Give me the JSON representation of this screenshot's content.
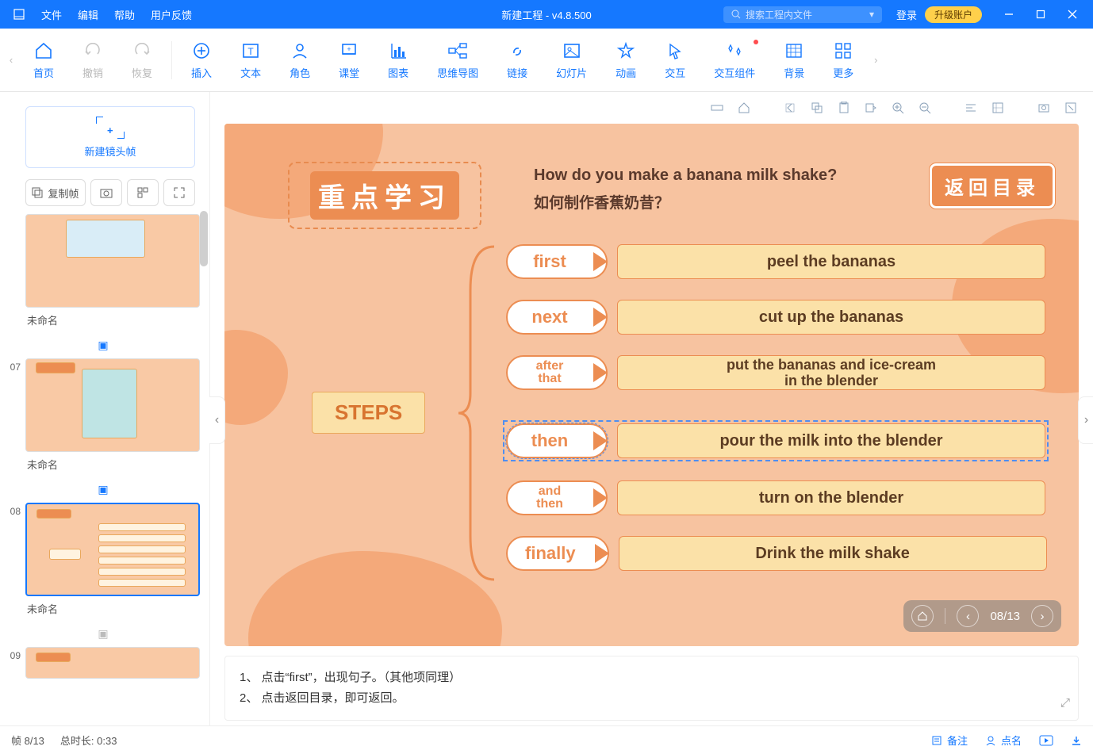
{
  "titlebar": {
    "menus": [
      "文件",
      "编辑",
      "帮助",
      "用户反馈"
    ],
    "title": "新建工程 - v4.8.500",
    "search_placeholder": "搜索工程内文件",
    "login": "登录",
    "upgrade": "升级账户"
  },
  "toolbar": {
    "home": "首页",
    "undo": "撤销",
    "redo": "恢复",
    "insert": "插入",
    "text": "文本",
    "role": "角色",
    "class": "课堂",
    "chart": "图表",
    "mindmap": "思维导图",
    "link": "链接",
    "slide": "幻灯片",
    "anim": "动画",
    "interact": "交互",
    "component": "交互组件",
    "bg": "背景",
    "more": "更多"
  },
  "leftpanel": {
    "newslide": "新建镜头帧",
    "copy": "复制帧",
    "slides": [
      {
        "num": "",
        "name": "未命名"
      },
      {
        "num": "07",
        "name": "未命名"
      },
      {
        "num": "08",
        "name": "未命名"
      },
      {
        "num": "09",
        "name": ""
      }
    ]
  },
  "canvas": {
    "title": "重点学习",
    "q_en": "How do you make a banana milk shake?",
    "q_zh": "如何制作香蕉奶昔？",
    "back": "返回目录",
    "steps_label": "STEPS",
    "steps": [
      {
        "label": "first",
        "text": "peel the bananas"
      },
      {
        "label": "next",
        "text": "cut up the bananas"
      },
      {
        "label": "after that",
        "text": "put the bananas and ice-cream in the blender",
        "two": true,
        "lab_two": true
      },
      {
        "label": "then",
        "text": "pour the milk into the blender",
        "selected": true
      },
      {
        "label": "and then",
        "text": "turn on the blender",
        "lab_two": true
      },
      {
        "label": "finally",
        "text": "Drink the milk shake"
      }
    ],
    "page": "08/13"
  },
  "notes": {
    "line1": "1、 点击“first”，出现句子。（其他项同理）",
    "line2": "2、 点击返回目录，即可返回。"
  },
  "status": {
    "left1": "帧 8/13",
    "left2": "总时长: 0:33",
    "remark": "备注",
    "roll": "点名"
  }
}
